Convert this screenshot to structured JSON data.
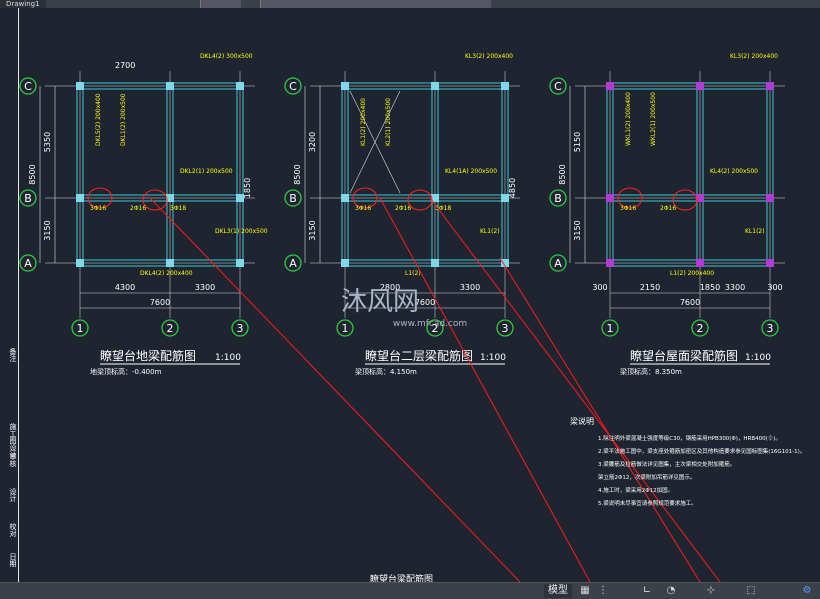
{
  "app": {
    "tab_label": "Drawing1",
    "accent": "#ffff00"
  },
  "plans": [
    {
      "id": "ground",
      "title": "瞭望台地梁配筋图",
      "scale": "1:100",
      "elevation": "地梁顶标高：-0.400m",
      "dims_top": "2700",
      "dims_left": [
        "5350",
        "8500",
        "3150"
      ],
      "dims_right": [
        "1850"
      ],
      "dims_bottom": [
        "4300",
        "3300"
      ],
      "dims_total": "7600",
      "axes_row": [
        "C",
        "B",
        "A"
      ],
      "axes_col": [
        "1",
        "2",
        "3"
      ],
      "beam_notes": [
        "DKL4(2) 300x500",
        "DKL5(2) 200x400",
        "DKL1(2) 200x500",
        "DKL2(1) 200x500",
        "DKL3(1) 200x500",
        "DKL4(2) 200x400"
      ],
      "rebars": [
        "3Φ16",
        "2Φ16",
        "3Φ18"
      ]
    },
    {
      "id": "floor2",
      "title": "瞭望台二层梁配筋图",
      "scale": "1:100",
      "elevation": "梁顶标高：4.150m",
      "dims_top": "",
      "dims_left": [
        "3200",
        "8500",
        "3150"
      ],
      "dims_right": [
        "4850"
      ],
      "dims_bottom": [
        "2800",
        "3300"
      ],
      "dims_total": "7600",
      "axes_row": [
        "C",
        "B",
        "A"
      ],
      "axes_col": [
        "1",
        "2",
        "3"
      ],
      "beam_notes": [
        "KL3(2) 200x400",
        "KL1(2) 200x400",
        "KL2(1) 200x500",
        "KL4(1A) 200x500",
        "KL1(2)",
        "L1(2)"
      ],
      "rebars": [
        "3Φ16",
        "2Φ16",
        "3Φ18"
      ]
    },
    {
      "id": "roof",
      "title": "瞭望台屋面梁配筋图",
      "scale": "1:100",
      "elevation": "梁顶标高：8.350m",
      "dims_top": "",
      "dims_left": [
        "5150",
        "8500",
        "3150"
      ],
      "dims_right": [],
      "dims_bottom": [
        "300",
        "2150",
        "1850",
        "3300",
        "300"
      ],
      "dims_total": "7600",
      "axes_row": [
        "C",
        "B",
        "A"
      ],
      "axes_col": [
        "1",
        "2",
        "3"
      ],
      "beam_notes": [
        "KL3(2) 200x400",
        "WKL1(2) 200x400",
        "WKL2(1) 200x500",
        "KL4(2) 200x500",
        "KL1(2)",
        "L1(2) 200x400"
      ],
      "rebars": [
        "3Φ16",
        "2Φ16"
      ]
    }
  ],
  "notes": {
    "heading": "梁说明",
    "lines": [
      "1.除注明外梁混凝土强度等级C30，钢筋采用HPB300(Φ)，HRB400(⏀)。",
      "2.梁平法施工图中，梁支座处箍筋加密区及其他构造要求参见国标图集(16G101-1)。",
      "3.梁腰筋及拉筋做法详见图集，主次梁相交处附加箍筋。",
      "  架立筋2Φ12，次梁附加吊筋详见图示。",
      "4.施工时，梁采用2Φ12加固。",
      "5.梁说明未尽事宜请参照规范要求施工。"
    ]
  },
  "bottom_label": "瞭望台梁配筋图",
  "watermark": {
    "brand": "沐风网",
    "url": "www.mfcad.com"
  },
  "side_labels": [
    "备注",
    "施工图设计",
    "审核",
    "设计",
    "校对",
    "日期"
  ],
  "status": {
    "model_label": "模型"
  }
}
